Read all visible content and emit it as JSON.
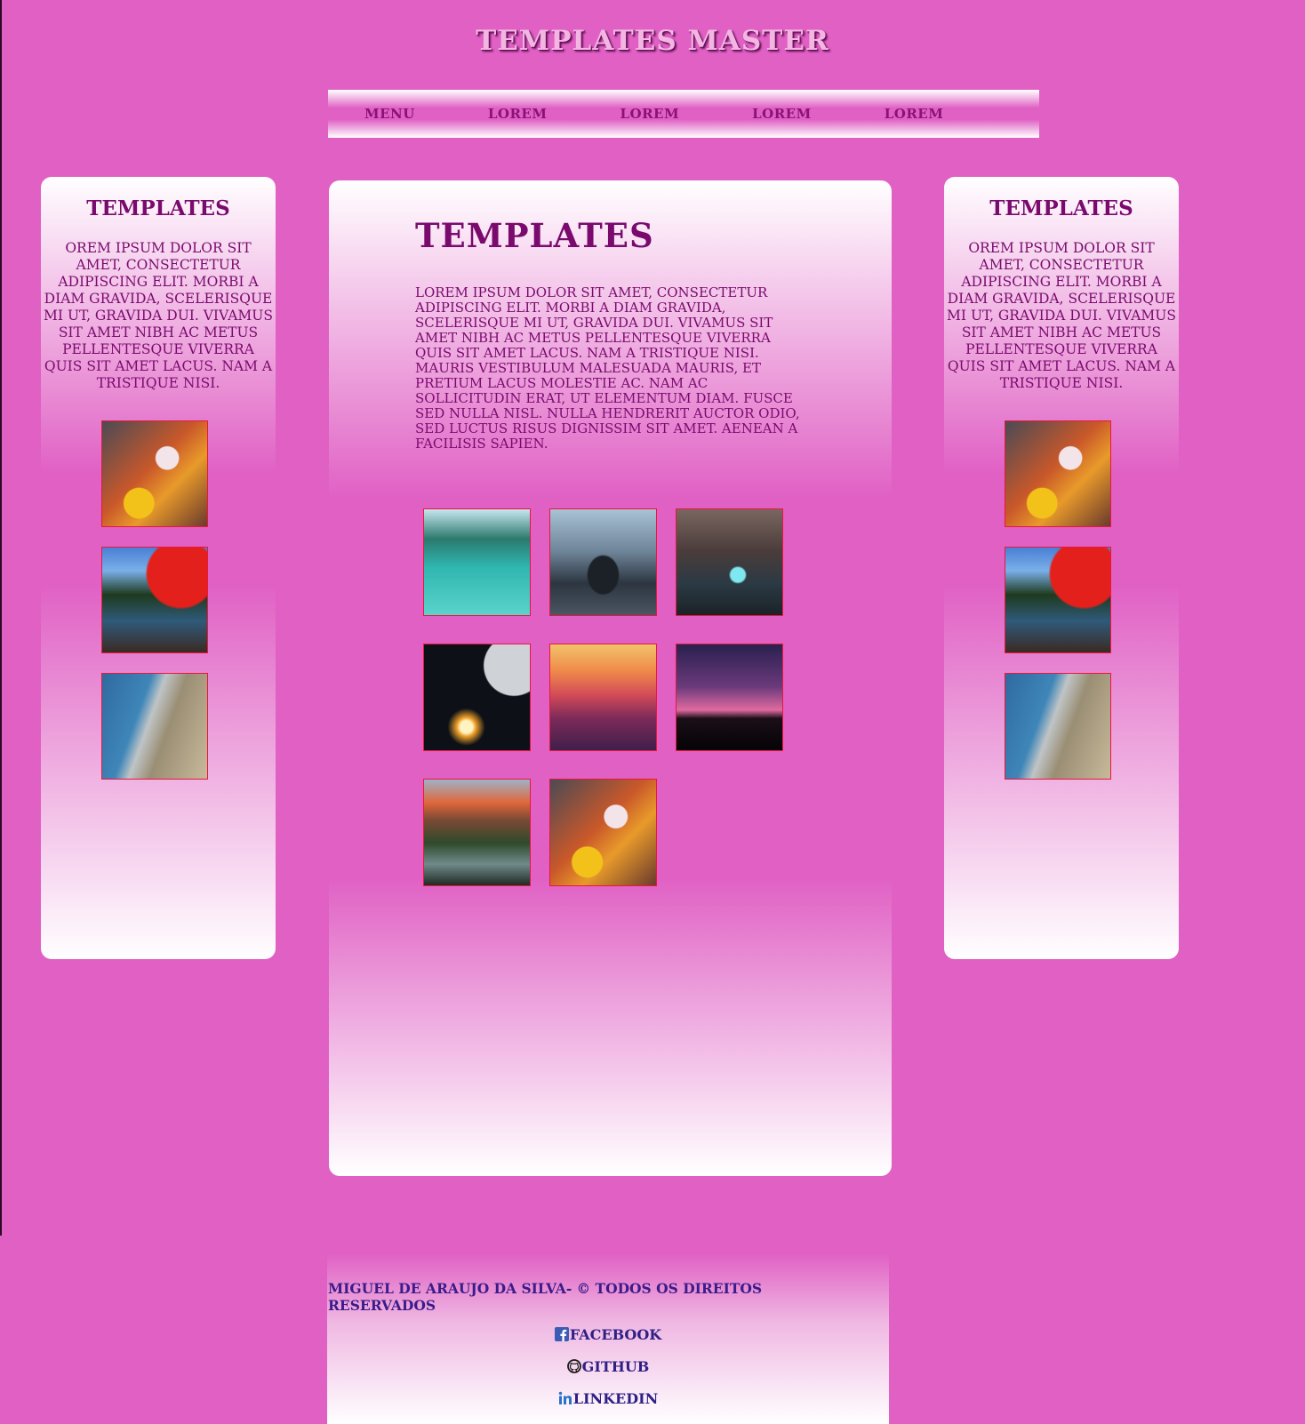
{
  "site": {
    "title": "Templates Master"
  },
  "nav": {
    "items": [
      "Menu",
      "Lorem",
      "Lorem",
      "Lorem",
      "Lorem"
    ]
  },
  "sidebar_left": {
    "title": "Templates",
    "text": "orem ipsum dolor sit amet, consectetur adipiscing elit. Morbi a diam gravida, scelerisque mi ut, gravida dui. Vivamus sit amet nibh ac metus pellentesque viverra quis sit amet lacus. Nam a tristique nisi.",
    "images": [
      "hero-warrior",
      "autumn-lake",
      "sea-cliff"
    ]
  },
  "main": {
    "title": "Templates",
    "text": "Lorem ipsum dolor sit amet, consectetur adipiscing elit. Morbi a diam gravida, scelerisque mi ut, gravida dui. Vivamus sit amet nibh ac metus pellentesque viverra quis sit amet lacus. Nam a tristique nisi. Mauris vestibulum malesuada mauris, et pretium lacus molestie ac. Nam ac sollicitudin erat, ut elementum diam. Fusce sed nulla nisl. Nulla hendrerit auctor odio, sed luctus risus dignissim sit amet. Aenean a facilisis sapien.",
    "gallery": [
      "mountain-lake",
      "truck-street",
      "temple-portal",
      "planet-sunrise",
      "canyon-sunset",
      "tree-silhouette",
      "mountain-river",
      "hero-warrior"
    ]
  },
  "sidebar_right": {
    "title": "Templates",
    "text": "orem ipsum dolor sit amet, consectetur adipiscing elit. Morbi a diam gravida, scelerisque mi ut, gravida dui. Vivamus sit amet nibh ac metus pellentesque viverra quis sit amet lacus. Nam a tristique nisi.",
    "images": [
      "hero-warrior",
      "autumn-lake",
      "sea-cliff"
    ]
  },
  "footer": {
    "copyright": "Miguel de Araujo da Silva- © Todos os direitos reservados",
    "links": {
      "facebook": "Facebook",
      "github": "Github",
      "linkedin": "Linkedin"
    }
  },
  "colors": {
    "background": "#e060c4",
    "text": "#7a0a6e",
    "footer_text": "#2f1f85",
    "thumb_border": "#e8173c"
  }
}
